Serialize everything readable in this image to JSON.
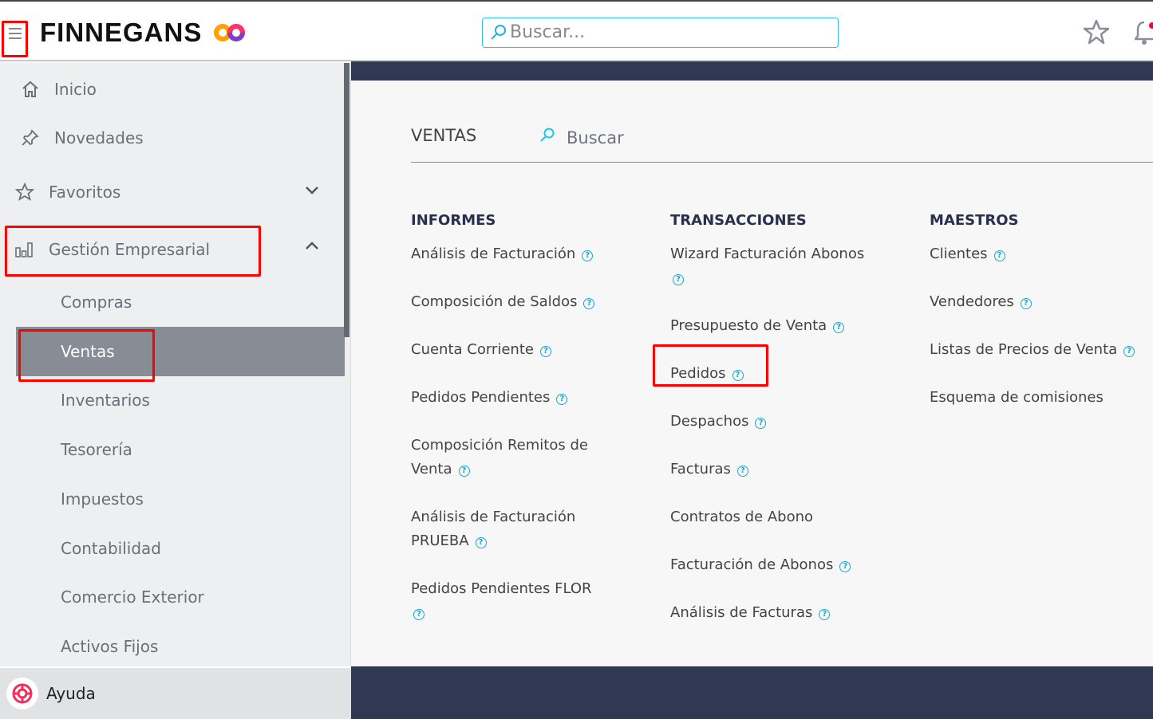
{
  "header": {
    "brand": "FINNEGANS",
    "search_placeholder": "Buscar..."
  },
  "sidebar": {
    "items": [
      {
        "label": "Inicio"
      },
      {
        "label": "Novedades"
      },
      {
        "label": "Favoritos"
      },
      {
        "label": "Gestión Empresarial"
      }
    ],
    "subitems": [
      {
        "label": "Compras"
      },
      {
        "label": "Ventas",
        "active": true
      },
      {
        "label": "Inventarios"
      },
      {
        "label": "Tesorería"
      },
      {
        "label": "Impuestos"
      },
      {
        "label": "Contabilidad"
      },
      {
        "label": "Comercio Exterior"
      },
      {
        "label": "Activos Fijos"
      }
    ],
    "help": "Ayuda"
  },
  "main": {
    "title": "VENTAS",
    "search_placeholder": "Buscar",
    "columns": [
      {
        "heading": "INFORMES",
        "items": [
          {
            "lines": [
              "Análisis de Facturación"
            ],
            "help": true
          },
          {
            "lines": [
              "Composición de Saldos"
            ],
            "help": true
          },
          {
            "lines": [
              "Cuenta Corriente"
            ],
            "help": true
          },
          {
            "lines": [
              "Pedidos Pendientes"
            ],
            "help": true
          },
          {
            "lines": [
              "Composición Remitos de",
              "Venta"
            ],
            "help": true
          },
          {
            "lines": [
              "Análisis de Facturación",
              "PRUEBA"
            ],
            "help": true
          },
          {
            "lines": [
              "Pedidos Pendientes FLOR"
            ],
            "help": true,
            "help_newline": true
          }
        ]
      },
      {
        "heading": "TRANSACCIONES",
        "items": [
          {
            "lines": [
              "Wizard Facturación Abonos"
            ],
            "help": true,
            "help_newline": true
          },
          {
            "lines": [
              "Presupuesto de Venta"
            ],
            "help": true
          },
          {
            "lines": [
              "Pedidos"
            ],
            "help": true,
            "highlighted": true
          },
          {
            "lines": [
              "Despachos"
            ],
            "help": true
          },
          {
            "lines": [
              "Facturas"
            ],
            "help": true
          },
          {
            "lines": [
              "Contratos de Abono"
            ],
            "help": false
          },
          {
            "lines": [
              "Facturación de Abonos"
            ],
            "help": true
          },
          {
            "lines": [
              "Análisis de Facturas"
            ],
            "help": true
          }
        ]
      },
      {
        "heading": "MAESTROS",
        "items": [
          {
            "lines": [
              "Clientes"
            ],
            "help": true
          },
          {
            "lines": [
              "Vendedores"
            ],
            "help": true
          },
          {
            "lines": [
              "Listas de Precios de Venta"
            ],
            "help": true
          },
          {
            "lines": [
              "Esquema de comisiones"
            ],
            "help": false
          }
        ]
      }
    ]
  },
  "colors": {
    "accent": "#1fb5d6",
    "navy": "#2f3a52",
    "highlight": "#ff0000"
  }
}
